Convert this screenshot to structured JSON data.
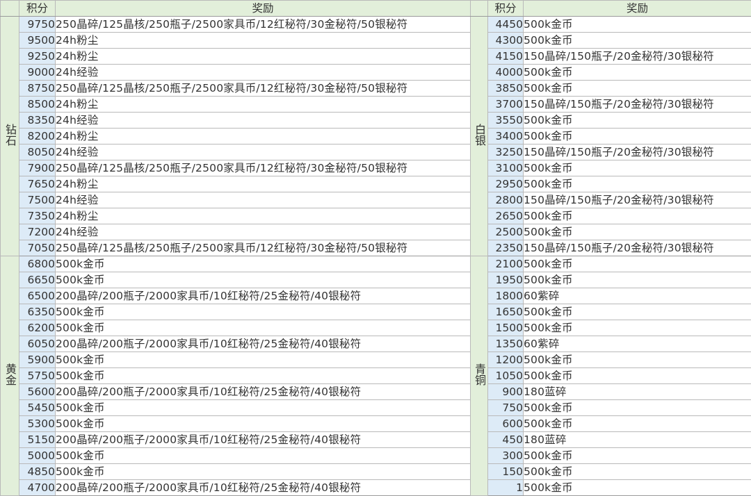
{
  "header": {
    "tier": "",
    "score": "积分",
    "reward": "奖励"
  },
  "left_table": {
    "groups": [
      {
        "tier": "钻石",
        "rows": [
          {
            "score": "9750",
            "reward": "250晶碎/125晶核/250瓶子/2500家具币/12红秘符/30金秘符/50银秘符"
          },
          {
            "score": "9500",
            "reward": "24h粉尘"
          },
          {
            "score": "9250",
            "reward": "24h粉尘"
          },
          {
            "score": "9000",
            "reward": "24h经验"
          },
          {
            "score": "8750",
            "reward": "250晶碎/125晶核/250瓶子/2500家具币/12红秘符/30金秘符/50银秘符"
          },
          {
            "score": "8500",
            "reward": "24h粉尘"
          },
          {
            "score": "8350",
            "reward": "24h经验"
          },
          {
            "score": "8200",
            "reward": "24h粉尘"
          },
          {
            "score": "8050",
            "reward": "24h经验"
          },
          {
            "score": "7900",
            "reward": "250晶碎/125晶核/250瓶子/2500家具币/12红秘符/30金秘符/50银秘符"
          },
          {
            "score": "7650",
            "reward": "24h粉尘"
          },
          {
            "score": "7500",
            "reward": "24h经验"
          },
          {
            "score": "7350",
            "reward": "24h粉尘"
          },
          {
            "score": "7200",
            "reward": "24h经验"
          },
          {
            "score": "7050",
            "reward": "250晶碎/125晶核/250瓶子/2500家具币/12红秘符/30金秘符/50银秘符"
          }
        ]
      },
      {
        "tier": "黄金",
        "rows": [
          {
            "score": "6800",
            "reward": "500k金币"
          },
          {
            "score": "6650",
            "reward": "500k金币"
          },
          {
            "score": "6500",
            "reward": "200晶碎/200瓶子/2000家具币/10红秘符/25金秘符/40银秘符"
          },
          {
            "score": "6350",
            "reward": "500k金币"
          },
          {
            "score": "6200",
            "reward": "500k金币"
          },
          {
            "score": "6050",
            "reward": "200晶碎/200瓶子/2000家具币/10红秘符/25金秘符/40银秘符"
          },
          {
            "score": "5900",
            "reward": "500k金币"
          },
          {
            "score": "5750",
            "reward": "500k金币"
          },
          {
            "score": "5600",
            "reward": "200晶碎/200瓶子/2000家具币/10红秘符/25金秘符/40银秘符"
          },
          {
            "score": "5450",
            "reward": "500k金币"
          },
          {
            "score": "5300",
            "reward": "500k金币"
          },
          {
            "score": "5150",
            "reward": "200晶碎/200瓶子/2000家具币/10红秘符/25金秘符/40银秘符"
          },
          {
            "score": "5000",
            "reward": "500k金币"
          },
          {
            "score": "4850",
            "reward": "500k金币"
          },
          {
            "score": "4700",
            "reward": "200晶碎/200瓶子/2000家具币/10红秘符/25金秘符/40银秘符"
          }
        ]
      }
    ]
  },
  "right_table": {
    "groups": [
      {
        "tier": "白银",
        "rows": [
          {
            "score": "4450",
            "reward": "500k金币"
          },
          {
            "score": "4300",
            "reward": "500k金币"
          },
          {
            "score": "4150",
            "reward": "150晶碎/150瓶子/20金秘符/30银秘符"
          },
          {
            "score": "4000",
            "reward": "500k金币"
          },
          {
            "score": "3850",
            "reward": "500k金币"
          },
          {
            "score": "3700",
            "reward": "150晶碎/150瓶子/20金秘符/30银秘符"
          },
          {
            "score": "3550",
            "reward": "500k金币"
          },
          {
            "score": "3400",
            "reward": "500k金币"
          },
          {
            "score": "3250",
            "reward": "150晶碎/150瓶子/20金秘符/30银秘符"
          },
          {
            "score": "3100",
            "reward": "500k金币"
          },
          {
            "score": "2950",
            "reward": "500k金币"
          },
          {
            "score": "2800",
            "reward": "150晶碎/150瓶子/20金秘符/30银秘符"
          },
          {
            "score": "2650",
            "reward": "500k金币"
          },
          {
            "score": "2500",
            "reward": "500k金币"
          },
          {
            "score": "2350",
            "reward": "150晶碎/150瓶子/20金秘符/30银秘符"
          }
        ]
      },
      {
        "tier": "青铜",
        "rows": [
          {
            "score": "2100",
            "reward": "500k金币"
          },
          {
            "score": "1950",
            "reward": "500k金币"
          },
          {
            "score": "1800",
            "reward": "60紫碎"
          },
          {
            "score": "1650",
            "reward": "500k金币"
          },
          {
            "score": "1500",
            "reward": "500k金币"
          },
          {
            "score": "1350",
            "reward": "60紫碎"
          },
          {
            "score": "1200",
            "reward": "500k金币"
          },
          {
            "score": "1050",
            "reward": "500k金币"
          },
          {
            "score": "900",
            "reward": "180蓝碎"
          },
          {
            "score": "750",
            "reward": "500k金币"
          },
          {
            "score": "600",
            "reward": "500k金币"
          },
          {
            "score": "450",
            "reward": "180蓝碎"
          },
          {
            "score": "300",
            "reward": "500k金币"
          },
          {
            "score": "150",
            "reward": "500k金币"
          },
          {
            "score": "1",
            "reward": "500k金币"
          }
        ]
      }
    ]
  },
  "colors": {
    "header_bg": "#e2efda",
    "tier_bg": "#e2efda",
    "score_bg": "#ddebf7",
    "grid_line": "#b9b9b9"
  }
}
